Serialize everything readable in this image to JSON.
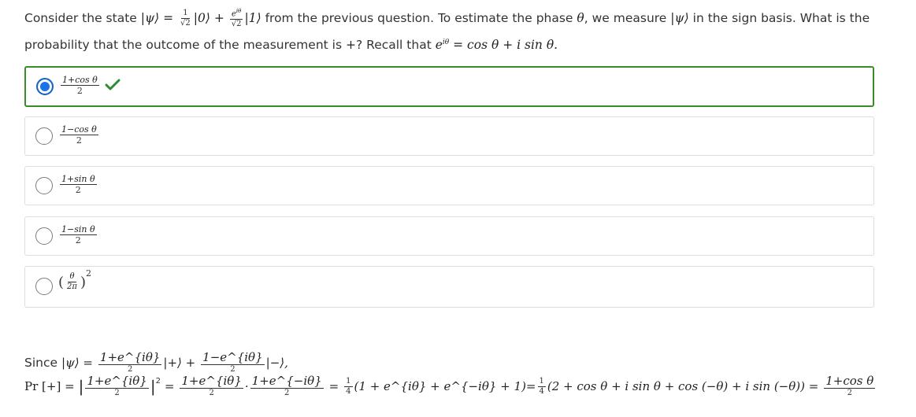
{
  "question": {
    "text_part1": "Consider the state",
    "state_symbol": "|ψ⟩ =",
    "coef0_num": "1",
    "coef0_den": "√2",
    "ket0": "|0⟩ +",
    "coef1_num": "e",
    "coef1_sup": "iθ",
    "coef1_den": "√2",
    "ket1": "|1⟩",
    "text_part2": "from the previous question. To estimate the phase",
    "theta": "θ",
    "text_part3": ", we measure",
    "psi": "|ψ⟩",
    "text_part4": "in the sign basis. What is the probability that the outcome of the measurement is",
    "plus": "+",
    "text_part5": "? Recall that",
    "euler_lhs": "e",
    "euler_sup": "iθ",
    "euler_rhs": "= cos θ + i sin θ."
  },
  "options": [
    {
      "num": "1+cos θ",
      "den": "2",
      "selected": true,
      "correct": true
    },
    {
      "num": "1−cos θ",
      "den": "2",
      "selected": false,
      "correct": false
    },
    {
      "num": "1+sin θ",
      "den": "2",
      "selected": false,
      "correct": false
    },
    {
      "num": "1−sin θ",
      "den": "2",
      "selected": false,
      "correct": false
    },
    {
      "num": "θ",
      "den": "2π",
      "exponent": "2",
      "selected": false,
      "correct": false
    }
  ],
  "solution": {
    "since": "Since",
    "line1": "|ψ⟩ =",
    "l1_f1_num": "1+e^{iθ}",
    "l1_f1_den": "2",
    "l1_mid": "|+⟩ +",
    "l1_f2_num": "1−e^{iθ}",
    "l1_f2_den": "2",
    "l1_end": "|−⟩,",
    "pr": "Pr [+] =",
    "l2_abs_num": "1+e^{iθ}",
    "l2_abs_den": "2",
    "l2_sq": "2",
    "l2_eq": "=",
    "l2_f1_num": "1+e^{iθ}",
    "l2_f1_den": "2",
    "l2_dot": "·",
    "l2_f2_num": "1+e^{−iθ}",
    "l2_f2_den": "2",
    "l2_q1_num": "1",
    "l2_q1_den": "4",
    "l2_expr1": "(1 + e^{iθ} + e^{−iθ} + 1)=",
    "l2_q2_num": "1",
    "l2_q2_den": "4",
    "l2_expr2": "(2 + cos θ + i sin θ + cos (−θ) + i sin (−θ)) =",
    "l2_res_num": "1+cos θ",
    "l2_res_den": "2"
  },
  "colors": {
    "correct_border": "#3a8b2a",
    "check": "#2e8b2e",
    "radio_selected": "#1a73e8"
  }
}
